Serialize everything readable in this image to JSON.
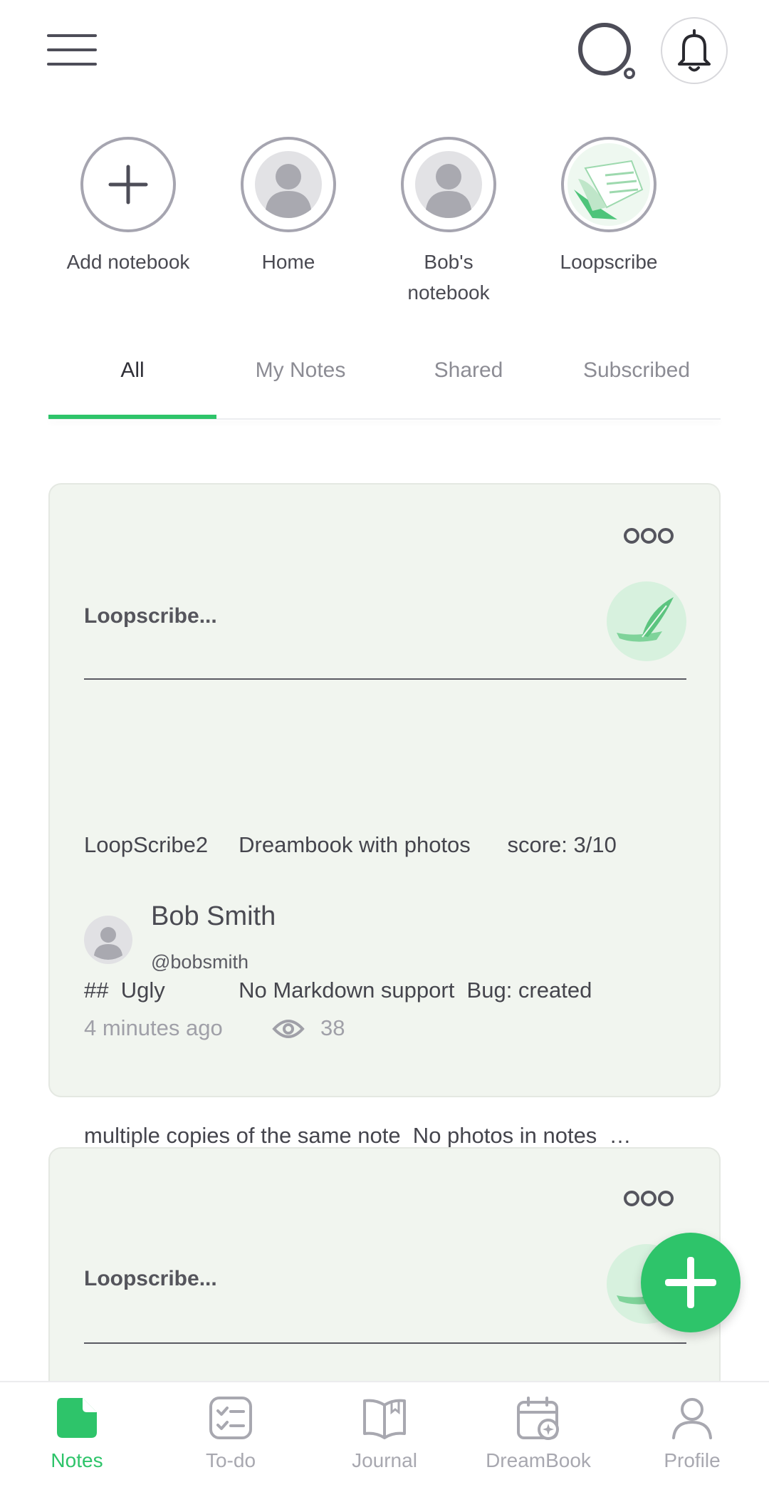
{
  "header": {
    "menu_icon": "hamburger-menu-icon",
    "search_icon": "search-icon",
    "bell_icon": "bell-icon"
  },
  "notebooks": [
    {
      "label": "Add notebook",
      "icon": "plus-icon"
    },
    {
      "label": "Home",
      "icon": "avatar-placeholder-icon"
    },
    {
      "label": "Bob's notebook",
      "icon": "avatar-placeholder-icon"
    },
    {
      "label": "Loopscribe",
      "icon": "loopscribe-logo-icon"
    }
  ],
  "tabs": [
    {
      "label": "All",
      "active": true
    },
    {
      "label": "My Notes"
    },
    {
      "label": "Shared"
    },
    {
      "label": "Subscribed"
    }
  ],
  "cards": [
    {
      "title": "Loopscribe...",
      "body_lines": [
        "LoopScribe2     Dreambook with photos      score: 3/10",
        "##  Ugly            No Markdown support  Bug: created",
        "multiple copies of the same note  No photos in notes  …"
      ],
      "author_name": "Bob Smith",
      "author_handle": "@bobsmith",
      "time": "4 minutes ago",
      "views": "38"
    },
    {
      "title": "Loopscribe..."
    }
  ],
  "bottom_nav": [
    {
      "label": "Notes",
      "icon": "notes-icon",
      "active": true
    },
    {
      "label": "To-do",
      "icon": "todo-checklist-icon"
    },
    {
      "label": "Journal",
      "icon": "journal-book-icon"
    },
    {
      "label": "DreamBook",
      "icon": "dreambook-calendar-icon"
    },
    {
      "label": "Profile",
      "icon": "profile-person-icon"
    }
  ],
  "colors": {
    "accent": "#2ec46a",
    "card_bg": "#f1f5ef"
  }
}
